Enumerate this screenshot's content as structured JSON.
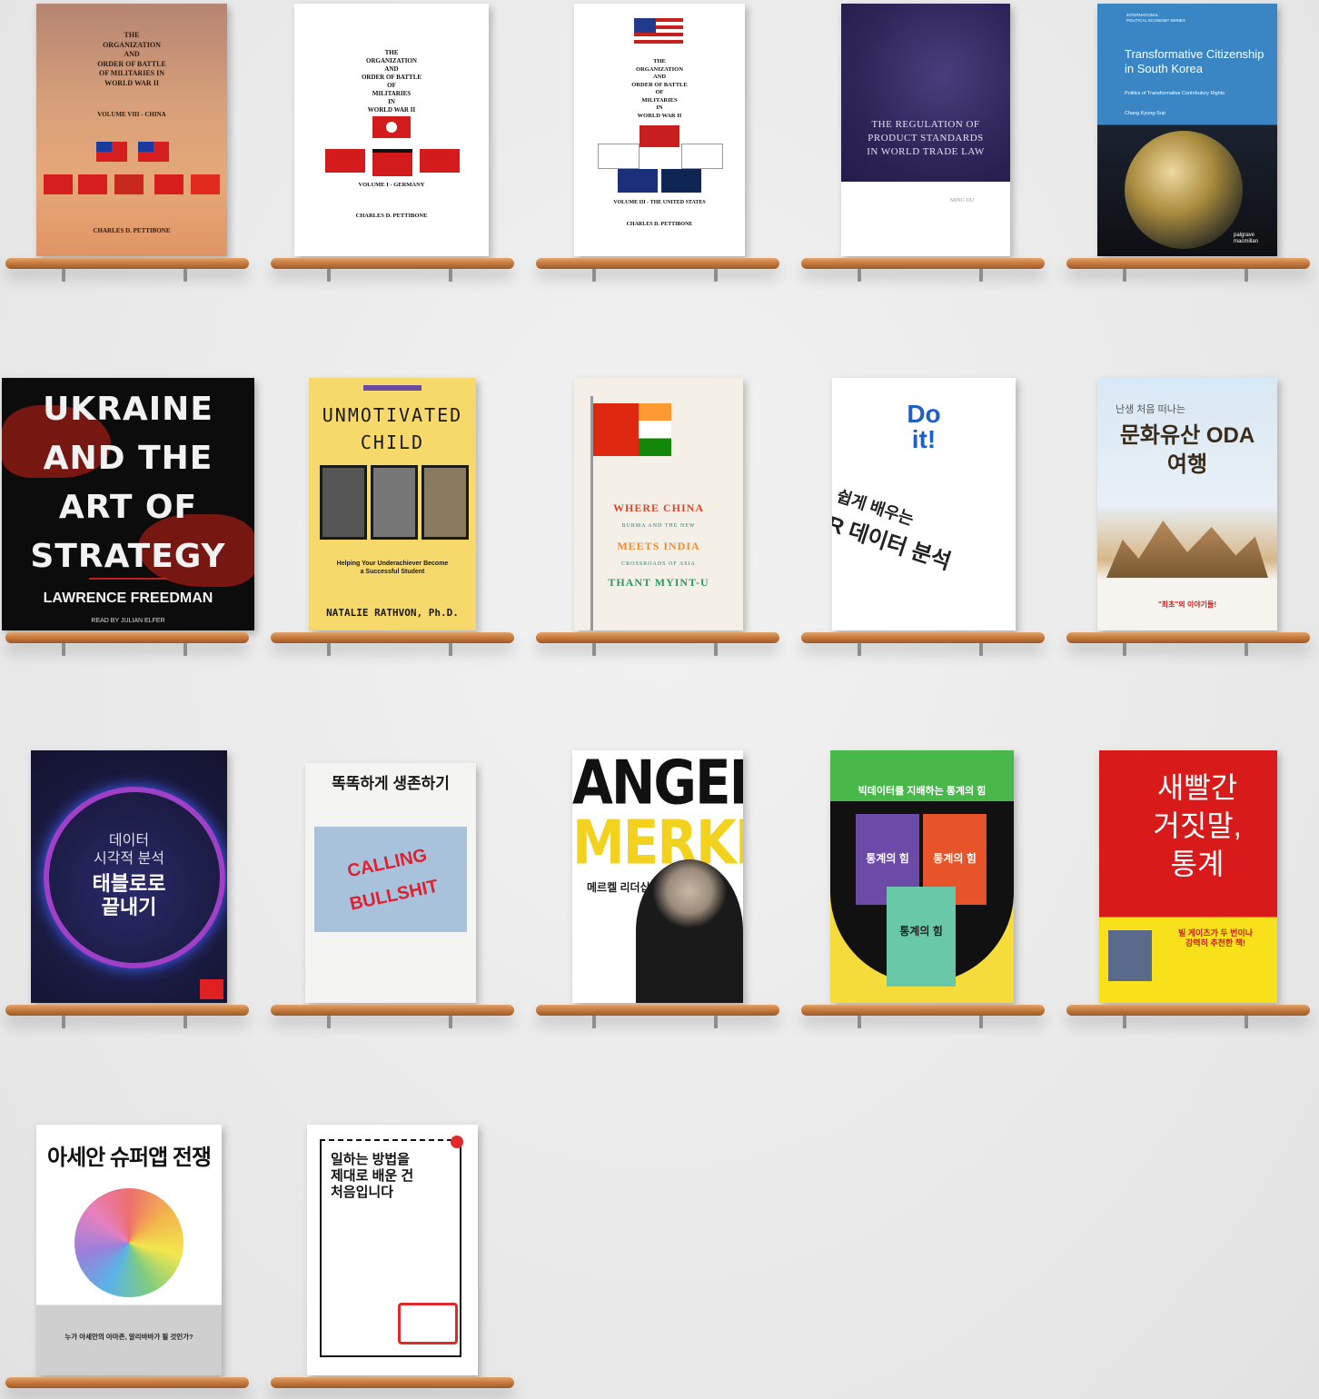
{
  "books": [
    {
      "id": "b1",
      "title_lines": "THE\nORGANIZATION\nAND\nORDER OF BATTLE\nOF MILITARIES IN\nWORLD WAR II",
      "volume": "VOLUME VIII - CHINA",
      "author": "CHARLES D. PETTIBONE"
    },
    {
      "id": "b2",
      "title_lines": "THE\nORGANIZATION\nAND\nORDER OF BATTLE\nOF\nMILITARIES\nIN\nWORLD WAR II",
      "volume": "VOLUME I - GERMANY",
      "author": "CHARLES D. PETTIBONE"
    },
    {
      "id": "b3",
      "title_lines": "THE\nORGANIZATION\nAND\nORDER OF BATTLE\nOF\nMILITARIES\nIN\nWORLD WAR II",
      "volume": "VOLUME III - THE UNITED STATES",
      "author": "CHARLES D. PETTIBONE"
    },
    {
      "id": "b4",
      "title_lines": "THE REGULATION OF\nPRODUCT STANDARDS\nIN WORLD TRADE LAW",
      "author": "MING DU"
    },
    {
      "id": "b5",
      "series": "INTERNATIONAL\nPOLITICAL ECONOMY SERIES",
      "title_lines": "Transformative Citizenship\nin South Korea",
      "subtitle": "Politics of Transformative Contributory Rights",
      "author": "Chang Kyung-Sup",
      "publisher": "palgrave\nmacmillan"
    },
    {
      "id": "b6",
      "title_lines": "UKRAINE\nAND THE\nART OF\nSTRATEGY",
      "author": "LAWRENCE FREEDMAN",
      "reader": "READ BY JULIAN ELFER"
    },
    {
      "id": "b7",
      "title_lines": "UNMOTIVATED\nCHILD",
      "subtitle": "Helping Your Underachiever Become\na Successful Student",
      "author": "NATALIE RATHVON, Ph.D."
    },
    {
      "id": "b8",
      "title_a": "WHERE CHINA",
      "title_b": "BURMA AND THE NEW",
      "title_c": "MEETS INDIA",
      "title_d": "CROSSROADS OF ASIA",
      "author": "THANT MYINT-U"
    },
    {
      "id": "b9",
      "brand": "Do\nit!",
      "title_a": "쉽게 배우는",
      "title_b": "R 데이터 분석"
    },
    {
      "id": "b10",
      "kicker": "난생 처음 떠나는",
      "title_lines": "문화유산 ODA\n여행",
      "tagline": "\"최초\"의 이야기들!"
    },
    {
      "id": "b11",
      "title_a": "데이터\n시각적 분석",
      "title_b": "태블로로\n끝내기"
    },
    {
      "id": "b12",
      "title_lines": "똑똑하게 생존하기",
      "art": "CALLING\nBULLSHIT"
    },
    {
      "id": "b13",
      "title_a": "ANGELA",
      "title_b": "MERKEL",
      "subtitle": "메르켈 리더십"
    },
    {
      "id": "b14",
      "header": "빅데이터를 지배하는 통계의 힘",
      "mini_a": "통계의 힘",
      "mini_b": "통계의 힘",
      "mini_c": "통계의 힘"
    },
    {
      "id": "b15",
      "title_lines": "새빨간\n거짓말,\n통계",
      "promo": "빌 게이츠가 두 번이나\n강력히 추천한 책!"
    },
    {
      "id": "b16",
      "title_lines": "아세안 슈퍼앱 전쟁",
      "question": "누가 아세안의 아마존, 알리바바가 될 것인가?"
    },
    {
      "id": "b17",
      "title_lines": "일하는 방법을\n제대로 배운 건\n처음입니다"
    }
  ],
  "colors": {
    "shelf": "#c97d3f",
    "wall": "#ececec"
  }
}
